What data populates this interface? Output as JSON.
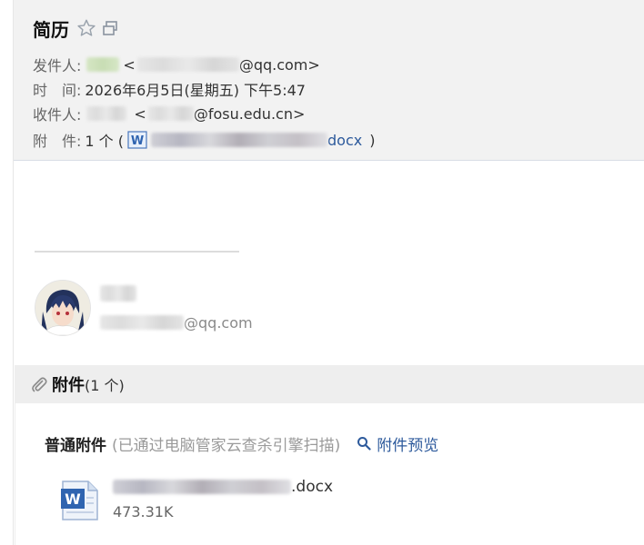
{
  "subject": "简历",
  "header": {
    "sender_label": "发件人:",
    "sender_email_suffix": "@qq.com>",
    "time_label": "时　间:",
    "time_value": "2026年6月5日(星期五) 下午5:47",
    "recipient_label": "收件人:",
    "recipient_email_suffix": "@fosu.edu.cn>",
    "attach_label": "附　件:",
    "attach_count": "1 个 (",
    "attach_ext": "docx",
    "attach_close": ")"
  },
  "signature": {
    "email_suffix": "@qq.com"
  },
  "attachments": {
    "title": "附件",
    "count": "(1 个)",
    "normal_label": "普通附件",
    "scan_note": "(已通过电脑管家云查杀引擎扫描)",
    "preview_label": "附件预览",
    "files": [
      {
        "name_suffix": ".docx",
        "size": "473.31K"
      }
    ]
  },
  "icons": {
    "star": "star-outline-icon",
    "popout": "popout-window-icon",
    "word": "word-doc-icon",
    "clip": "paperclip-icon",
    "search": "search-icon"
  },
  "colors": {
    "link": "#2d5a9c",
    "word_blue": "#2f64b0",
    "header_bg": "#f2f2f2"
  }
}
